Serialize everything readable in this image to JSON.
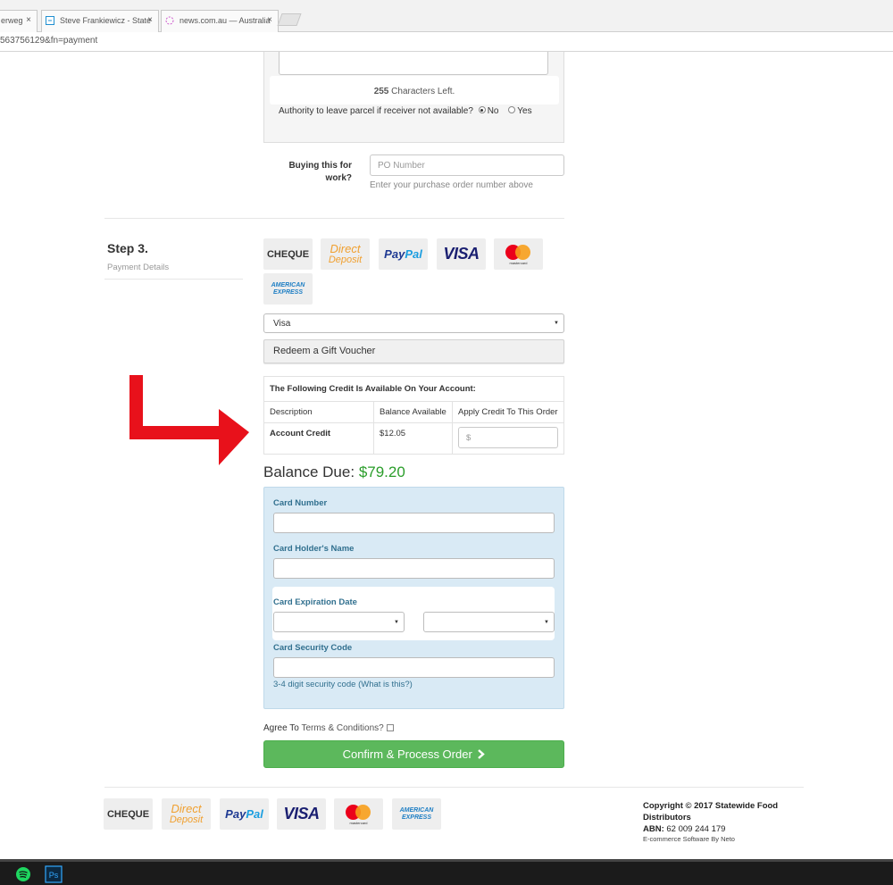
{
  "browser": {
    "tabs": [
      {
        "label": "erweg"
      },
      {
        "label": "Steve Frankiewicz - State"
      },
      {
        "label": "news.com.au — Australia"
      }
    ],
    "address": "563756129&fn=payment",
    "tab_close_glyph": "×"
  },
  "delivery": {
    "chars_count": "255",
    "chars_suffix": "Characters Left.",
    "authority_question": "Authority to leave parcel if receiver not available?",
    "authority_no": "No",
    "authority_yes": "Yes",
    "authority_selected": "No"
  },
  "po": {
    "label_line1": "Buying this for",
    "label_line2": "work?",
    "placeholder": "PO Number",
    "hint": "Enter your purchase order number above"
  },
  "step3": {
    "title": "Step 3.",
    "subtitle": "Payment Details"
  },
  "payment_methods": {
    "cheque": "CHEQUE",
    "direct_line1": "Direct",
    "direct_line2": "Deposit",
    "paypal_pay": "Pay",
    "paypal_pal": "Pal",
    "visa": "VISA",
    "mastercard": "mastercard",
    "amex_line1": "AMERICAN",
    "amex_line2": "EXPRESS"
  },
  "payment_select": {
    "selected": "Visa"
  },
  "voucher": {
    "label": "Redeem a Gift Voucher"
  },
  "credit": {
    "heading": "The Following Credit Is Available On Your Account:",
    "col_description": "Description",
    "col_balance": "Balance Available",
    "col_apply": "Apply Credit To This Order",
    "row_desc": "Account Credit",
    "row_balance": "$12.05",
    "apply_placeholder": "$"
  },
  "balance": {
    "label": "Balance Due:",
    "amount": "$79.20"
  },
  "card": {
    "number_label": "Card Number",
    "holder_label": "Card Holder's Name",
    "expiry_label": "Card Expiration Date",
    "cvv_label": "Card Security Code",
    "cvv_hint": "3-4 digit security code",
    "cvv_link": "(What is this?)"
  },
  "agree": {
    "prefix": "Agree To",
    "link": "Terms & Conditions?"
  },
  "confirm": {
    "label": "Confirm & Process Order"
  },
  "footer": {
    "copyright_line1": "Copyright © 2017 Statewide Food",
    "copyright_line2": "Distributors",
    "abn_label": "ABN:",
    "abn_value": "62 009 244 179",
    "ecom_prefix": "E-commerce Software By",
    "ecom_brand": "Neto"
  },
  "colors": {
    "arrow": "#e8111b",
    "balance_amount": "#2a9d2a",
    "confirm_button": "#5cb85c",
    "card_panel": "#d9eaf5",
    "card_label": "#31708f"
  },
  "icons": [
    "close-icon",
    "page-icon",
    "loading-icon",
    "caret-down-icon",
    "chevron-right-icon",
    "red-arrow-icon",
    "spotify-icon",
    "photoshop-icon"
  ]
}
